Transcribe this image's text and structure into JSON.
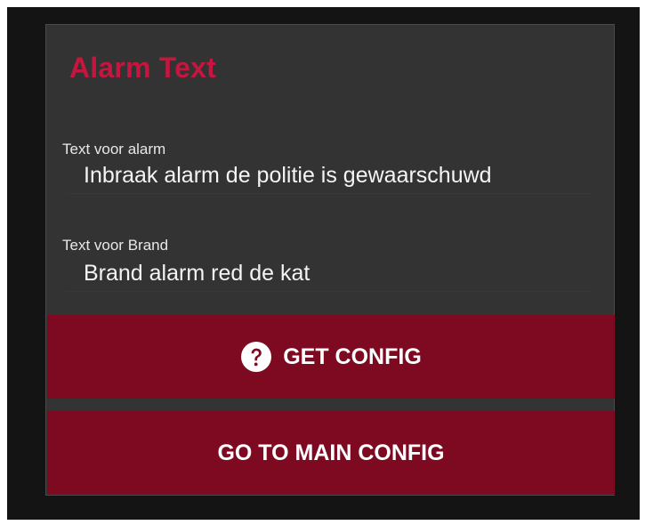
{
  "card": {
    "title": "Alarm Text"
  },
  "fields": {
    "alarm": {
      "label": "Text voor alarm",
      "value": "Inbraak alarm de politie is gewaarschuwd"
    },
    "brand": {
      "label": "Text voor Brand",
      "value": "Brand alarm red de kat"
    }
  },
  "buttons": {
    "get_config": "GET CONFIG",
    "main_config": "GO TO MAIN CONFIG"
  },
  "icons": {
    "get_config": "help-circle-icon"
  },
  "colors": {
    "accent": "#c4163e",
    "button": "#7d0a21",
    "card_background": "#333333",
    "page_background": "#141414"
  }
}
